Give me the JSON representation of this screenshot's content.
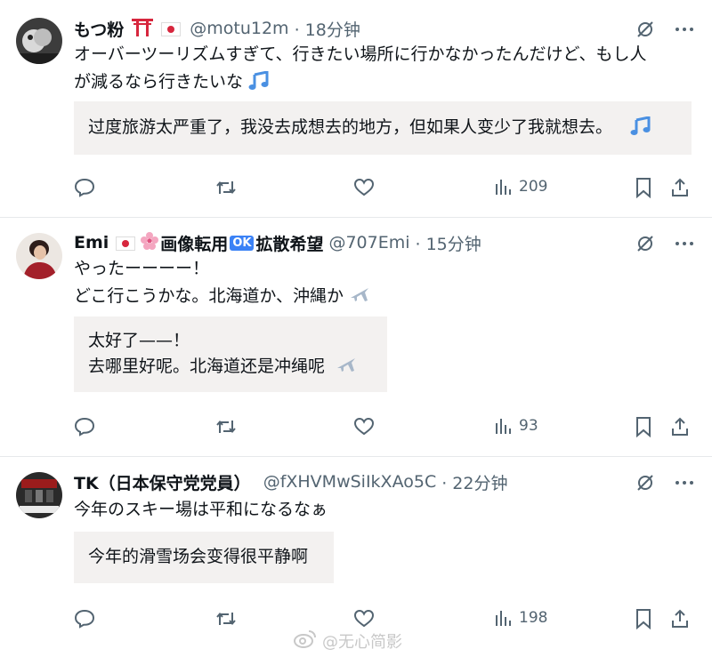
{
  "posts": [
    {
      "name": "もつ粉",
      "handle": "@motu12m",
      "time": "· 18分钟",
      "text_lines": [
        "オーバーツーリズムすぎて、行きたい場所に行かなかったんだけど、もし人",
        "が減るなら行きたいな"
      ],
      "translation_lines": [
        "过度旅游太严重了，我没去成想去的地方，但如果人变少了我就想去。"
      ],
      "views": "209"
    },
    {
      "name": "Emi",
      "name_extra": "画像転用",
      "ok": "OK",
      "name_extra2": "拡散希望",
      "handle": "@707Emi",
      "time": "· 15分钟",
      "text_lines": [
        "やったーーーー！",
        "どこ行こうかな。北海道か、沖縄か"
      ],
      "translation_lines": [
        "太好了——！",
        "去哪里好呢。北海道还是冲绳呢"
      ],
      "views": "93"
    },
    {
      "name": "TK（日本保守党党員）",
      "handle": "@fXHVMwSiIkXAo5C",
      "time": "· 22分钟",
      "text_lines": [
        "今年のスキー場は平和になるなぁ"
      ],
      "translation_lines": [
        "今年的滑雪场会变得很平静啊"
      ],
      "views": "198"
    }
  ],
  "watermark": "@无心简影",
  "colors": {
    "muted": "#536471",
    "translation_bg": "#f3f1f0",
    "music_note": "#4a90e2"
  }
}
